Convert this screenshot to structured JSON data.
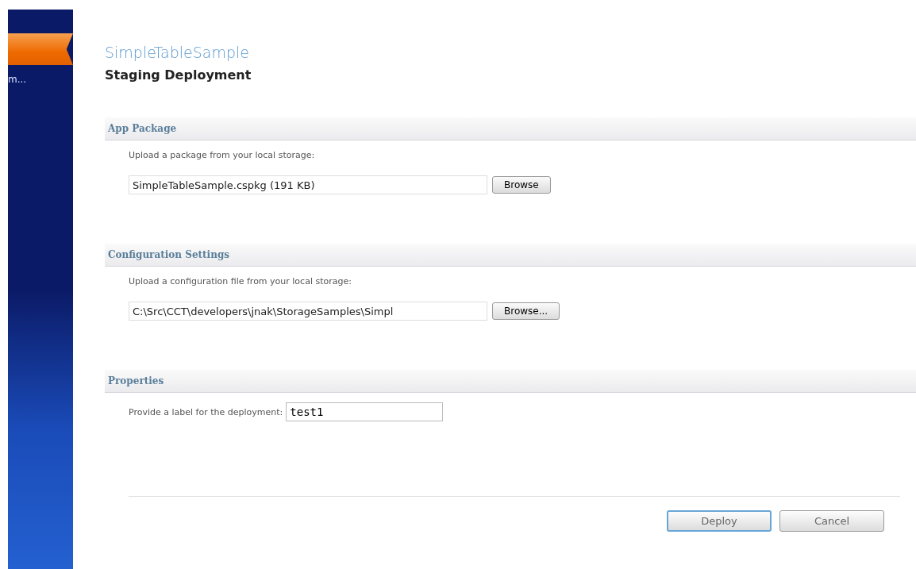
{
  "sidebar": {
    "items": [
      {
        "label": "m...",
        "selected": false
      }
    ],
    "active_tab": {
      "selected": true
    }
  },
  "title": "SimpleTableSample",
  "heading": "Staging Deployment",
  "sections": [
    {
      "header": "App Package",
      "kind": "file",
      "instruction": "Upload a package from your local storage:",
      "value": "SimpleTableSample.cspkg (191 KB)",
      "button": "Browse"
    },
    {
      "header": "Configuration Settings",
      "kind": "file",
      "instruction": "Upload a configuration file from your local storage:",
      "value": "C:\\Src\\CCT\\developers\\jnak\\StorageSamples\\Simpl",
      "button": "Browse..."
    },
    {
      "header": "Properties",
      "kind": "text",
      "label": "Provide a label for the deployment:",
      "value": "test1"
    }
  ],
  "buttons": [
    {
      "label": "Deploy",
      "default": true
    },
    {
      "label": "Cancel",
      "default": false
    }
  ]
}
